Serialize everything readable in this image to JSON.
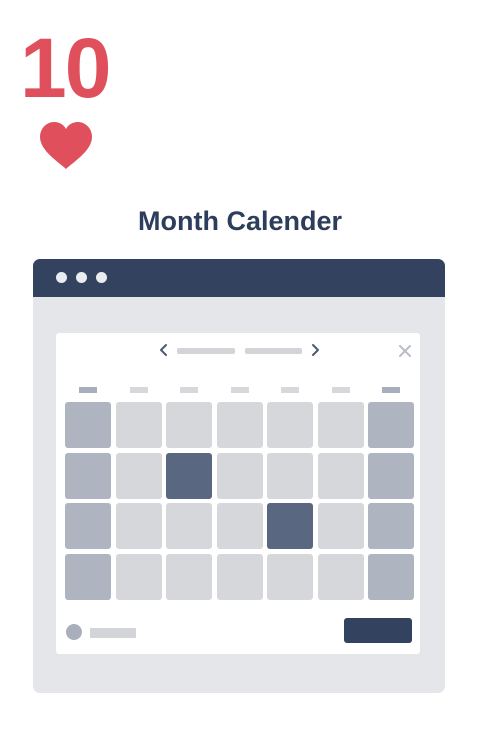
{
  "card": {
    "rank": "10",
    "suit_icon": "heart-icon",
    "color": "#e0505c"
  },
  "title": "Month Calender",
  "colors": {
    "title": "#2c3e5c",
    "window_bar": "#33425f",
    "window_bg": "#e4e6ea",
    "window_dot": "#e9ecf1",
    "panel": "#ffffff",
    "placeholder": "#d2d4d8",
    "day": "#d5d7db",
    "weekend": "#aeb4c0",
    "selected": "#5a6781",
    "weekday_mark": "#d6d8dc",
    "weekend_mark": "#a8afbc",
    "icon": "#4c5a75",
    "close_icon": "#b9bec8",
    "footer_dot": "#a9afbb",
    "footer_line": "#d2d4d8",
    "action_button": "#33425f"
  },
  "icons": {
    "prev": "chevron-left-icon",
    "next": "chevron-right-icon",
    "close": "close-icon"
  },
  "calendar": {
    "columns": 7,
    "rows": 4,
    "weekend_columns": [
      0,
      6
    ],
    "selected_days": [
      [
        1,
        2
      ],
      [
        2,
        4
      ]
    ]
  }
}
